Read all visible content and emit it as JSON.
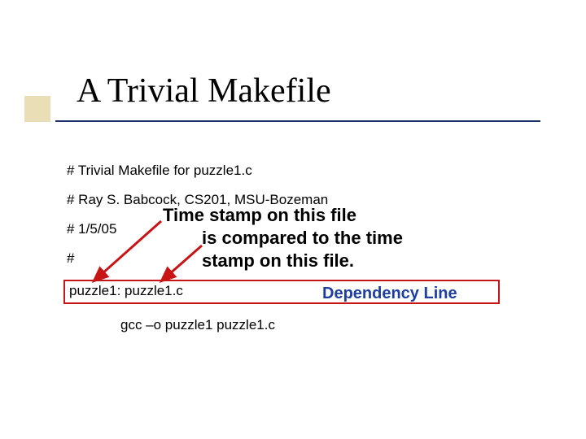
{
  "title": "A Trivial Makefile",
  "comments": {
    "l1": "# Trivial Makefile for puzzle1.c",
    "l2": "# Ray S. Babcock, CS201, MSU-Bozeman",
    "l3": "# 1/5/05",
    "l4": "#"
  },
  "dependency_line": "puzzle1: puzzle1.c",
  "dependency_label": "Dependency Line",
  "command_line": "gcc –o puzzle1 puzzle1.c",
  "annotation": {
    "l1": "Time stamp on this file",
    "l2": "is compared to the time",
    "l3": "stamp on this file."
  },
  "colors": {
    "accent_square": "#d9c27a",
    "underline": "#1c2f6b",
    "box_border": "#c81414",
    "arrow": "#c81414",
    "dependency_label": "#1c3fa0"
  }
}
